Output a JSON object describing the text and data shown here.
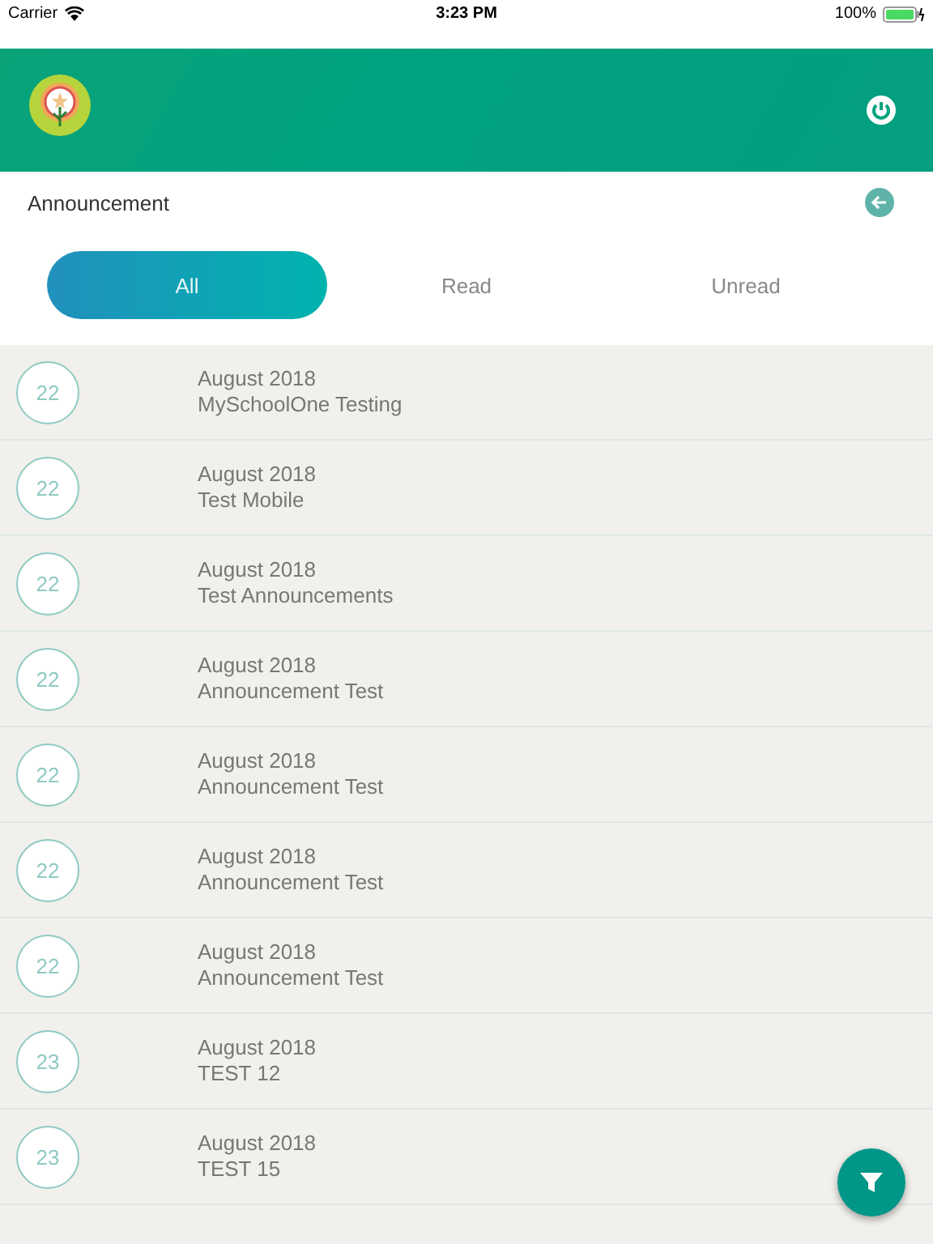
{
  "status_bar": {
    "carrier": "Carrier",
    "time": "3:23 PM",
    "battery": "100%"
  },
  "page_title": "Announcement",
  "tabs": [
    {
      "label": "All",
      "selected": true
    },
    {
      "label": "Read",
      "selected": false
    },
    {
      "label": "Unread",
      "selected": false
    }
  ],
  "announcements": [
    {
      "day": "22",
      "month": "August 2018",
      "title": "MySchoolOne Testing"
    },
    {
      "day": "22",
      "month": "August 2018",
      "title": "Test Mobile"
    },
    {
      "day": "22",
      "month": "August 2018",
      "title": "Test Announcements"
    },
    {
      "day": "22",
      "month": "August 2018",
      "title": "Announcement Test"
    },
    {
      "day": "22",
      "month": "August 2018",
      "title": "Announcement Test"
    },
    {
      "day": "22",
      "month": "August 2018",
      "title": "Announcement Test"
    },
    {
      "day": "22",
      "month": "August 2018",
      "title": "Announcement Test"
    },
    {
      "day": "23",
      "month": "August 2018",
      "title": "TEST 12"
    },
    {
      "day": "23",
      "month": "August 2018",
      "title": "TEST 15"
    }
  ]
}
